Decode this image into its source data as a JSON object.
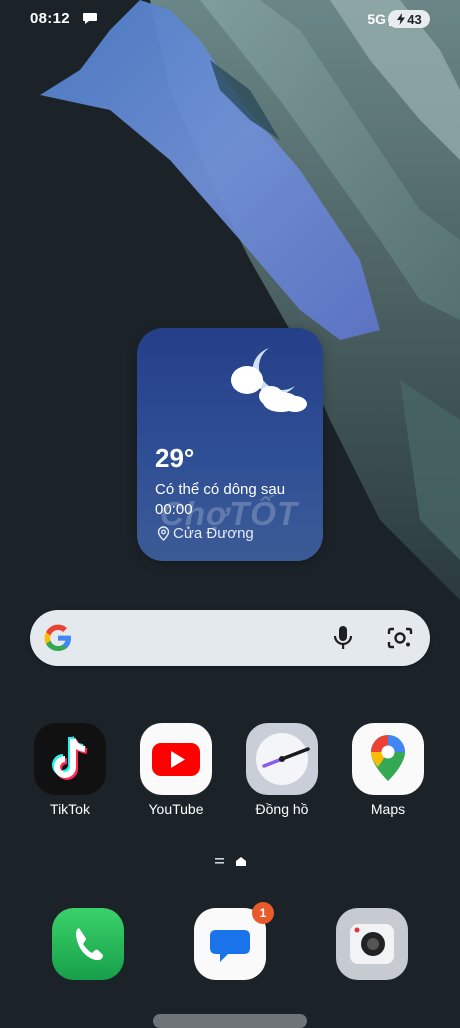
{
  "status_bar": {
    "time": "08:12",
    "network": "5G",
    "battery": "43"
  },
  "weather_widget": {
    "temperature": "29°",
    "condition": "Có thể có dông sau",
    "time": "00:00",
    "location": "Cửa Đương",
    "icon": "moon-cloud-icon"
  },
  "watermark": "ChợTỐT",
  "search_widget": {
    "icons": [
      "google-logo-icon",
      "microphone-icon",
      "google-lens-icon"
    ]
  },
  "home_apps": [
    {
      "label": "TikTok",
      "icon": "tiktok-icon"
    },
    {
      "label": "YouTube",
      "icon": "youtube-icon"
    },
    {
      "label": "Đồng hồ",
      "icon": "clock-icon"
    },
    {
      "label": "Maps",
      "icon": "maps-icon"
    }
  ],
  "dock": {
    "phone_icon": "phone-icon",
    "messages_icon": "messages-icon",
    "messages_badge": "1",
    "camera_icon": "camera-icon"
  },
  "colors": {
    "background": "#1b2329",
    "widget": "#2f4f95",
    "badge": "#e85a2a"
  }
}
